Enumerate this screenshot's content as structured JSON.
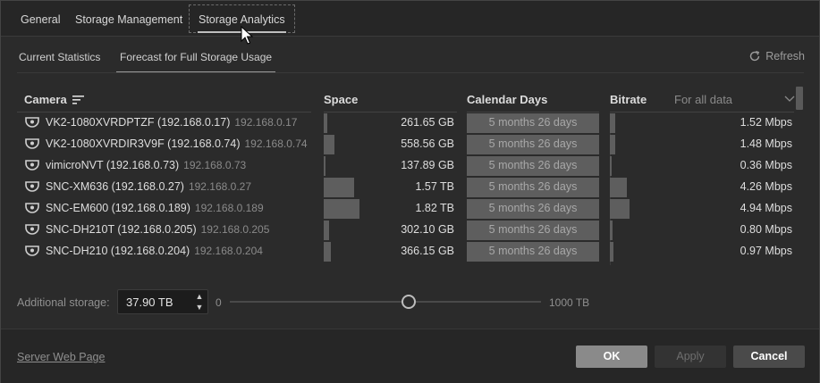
{
  "top_tabs": [
    {
      "label": "General"
    },
    {
      "label": "Storage Management"
    },
    {
      "label": "Storage Analytics"
    }
  ],
  "sub_tabs": [
    {
      "label": "Current Statistics"
    },
    {
      "label": "Forecast for Full Storage Usage"
    }
  ],
  "refresh_label": "Refresh",
  "table": {
    "headers": {
      "camera": "Camera",
      "space": "Space",
      "calendar_days": "Calendar Days",
      "bitrate": "Bitrate",
      "filter": "For all data"
    },
    "rows": [
      {
        "name": "VK2-1080XVRDPTZF (192.168.0.17)",
        "ip": "192.168.0.17",
        "space": "261.65 GB",
        "space_fill": 0.03,
        "days": "5 months 26 days",
        "bitrate": "1.52 Mbps",
        "bitrate_fill": 0.03
      },
      {
        "name": "VK2-1080XVRDIR3V9F (192.168.0.74)",
        "ip": "192.168.0.74",
        "space": "558.56 GB",
        "space_fill": 0.08,
        "days": "5 months 26 days",
        "bitrate": "1.48 Mbps",
        "bitrate_fill": 0.03
      },
      {
        "name": "vimicroNVT (192.168.0.73)",
        "ip": "192.168.0.73",
        "space": "137.89 GB",
        "space_fill": 0.015,
        "days": "5 months 26 days",
        "bitrate": "0.36 Mbps",
        "bitrate_fill": 0.005
      },
      {
        "name": "SNC-XM636 (192.168.0.27)",
        "ip": "192.168.0.27",
        "space": "1.57 TB",
        "space_fill": 0.23,
        "days": "5 months 26 days",
        "bitrate": "4.26 Mbps",
        "bitrate_fill": 0.09
      },
      {
        "name": "SNC-EM600 (192.168.0.189)",
        "ip": "192.168.0.189",
        "space": "1.82 TB",
        "space_fill": 0.27,
        "days": "5 months 26 days",
        "bitrate": "4.94 Mbps",
        "bitrate_fill": 0.105
      },
      {
        "name": "SNC-DH210T (192.168.0.205)",
        "ip": "192.168.0.205",
        "space": "302.10 GB",
        "space_fill": 0.04,
        "days": "5 months 26 days",
        "bitrate": "0.80 Mbps",
        "bitrate_fill": 0.015
      },
      {
        "name": "SNC-DH210 (192.168.0.204)",
        "ip": "192.168.0.204",
        "space": "366.15 GB",
        "space_fill": 0.055,
        "days": "5 months 26 days",
        "bitrate": "0.97 Mbps",
        "bitrate_fill": 0.02
      }
    ]
  },
  "additional_storage": {
    "label": "Additional storage:",
    "value": "37.90 TB",
    "slider_min": "0",
    "slider_max": "1000 TB"
  },
  "footer": {
    "server_link": "Server Web Page",
    "ok": "OK",
    "apply": "Apply",
    "cancel": "Cancel"
  },
  "icons": {
    "sort": "sort-icon",
    "refresh": "refresh-icon",
    "camera": "camera-icon",
    "chevron": "chevron-down-icon"
  }
}
